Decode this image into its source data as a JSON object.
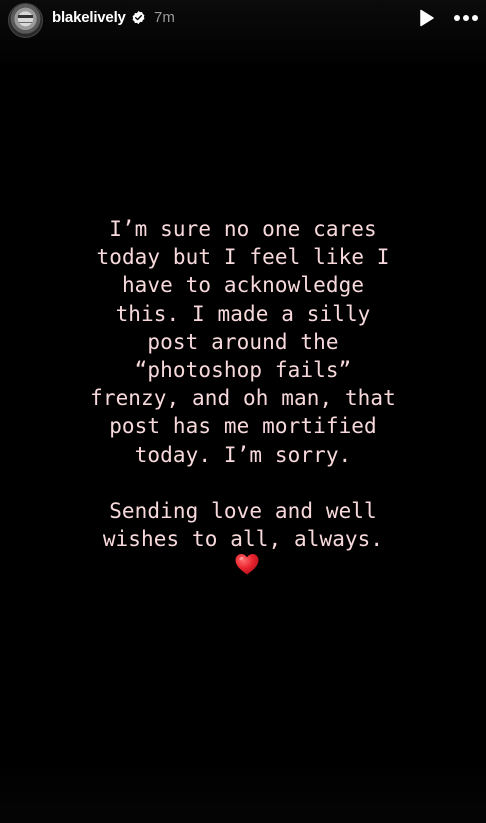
{
  "header": {
    "username": "blakelively",
    "verified": true,
    "timestamp": "7m",
    "play_icon": "play-icon",
    "more_icon": "more-horizontal-icon"
  },
  "story": {
    "text_color": "#f7d9dc",
    "background": "#000000",
    "paragraph1": [
      "I’m sure no one cares",
      "today but I feel like I",
      "have to acknowledge",
      "this. I made a silly",
      "post around the",
      "“photoshop fails”",
      "frenzy, and oh man, that",
      "post has me mortified",
      "today. I’m sorry."
    ],
    "paragraph2": [
      "Sending love and well",
      "wishes to all, always."
    ],
    "emoji": "red-heart-icon"
  }
}
